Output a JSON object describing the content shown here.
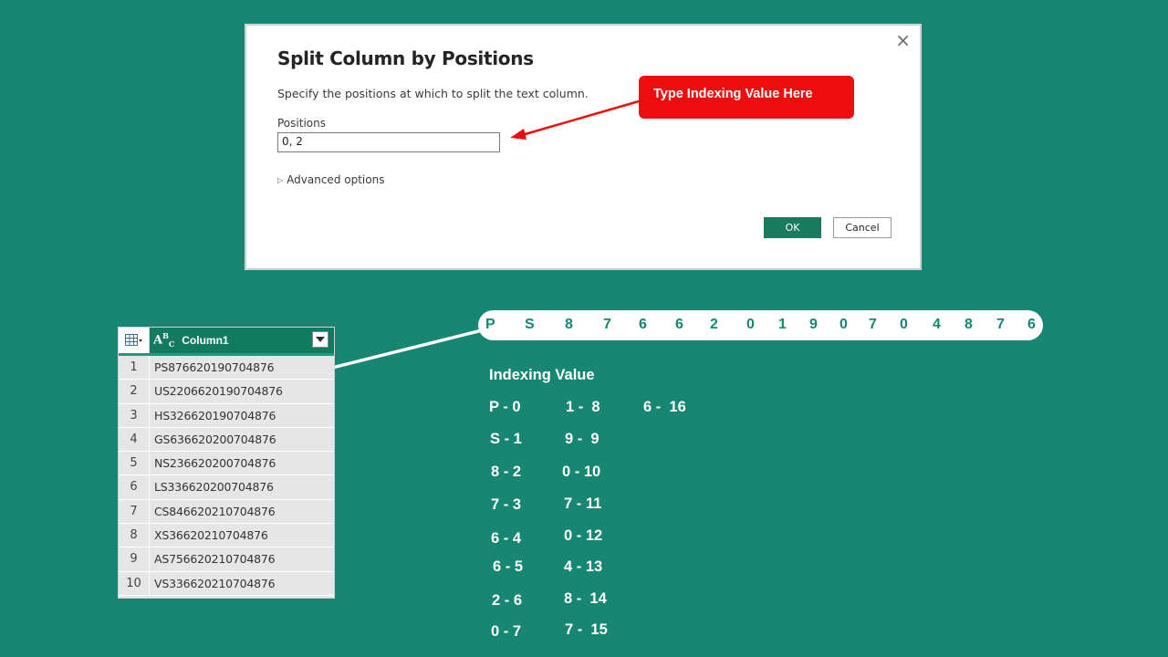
{
  "dialog": {
    "title": "Split Column by Positions",
    "subtitle": "Specify the positions at which to split the text column.",
    "positions_label": "Positions",
    "positions_value": "0, 2",
    "advanced_label": "Advanced options",
    "ok_label": "OK",
    "cancel_label": "Cancel",
    "close_glyph": "×"
  },
  "callout": {
    "text": "Type Indexing Value Here"
  },
  "grid": {
    "column_header": "Column1",
    "rows": [
      {
        "n": "1",
        "value": "PS876620190704876"
      },
      {
        "n": "2",
        "value": "US2206620190704876"
      },
      {
        "n": "3",
        "value": "HS326620190704876"
      },
      {
        "n": "4",
        "value": "GS636620200704876"
      },
      {
        "n": "5",
        "value": "NS236620200704876"
      },
      {
        "n": "6",
        "value": "LS336620200704876"
      },
      {
        "n": "7",
        "value": "CS846620210704876"
      },
      {
        "n": "8",
        "value": "XS36620210704876"
      },
      {
        "n": "9",
        "value": "AS756620210704876"
      },
      {
        "n": "10",
        "value": "VS336620210704876"
      }
    ]
  },
  "strip": {
    "chars": [
      "P",
      "S",
      "8",
      "7",
      "6",
      "6",
      "2",
      "0",
      "1",
      "9",
      "0",
      "7",
      "0",
      "4",
      "8",
      "7",
      "6"
    ]
  },
  "indexing": {
    "title": "Indexing Value",
    "pairs": [
      "P - 0",
      "S - 1",
      "8 - 2",
      "7 - 3",
      "6 - 4",
      "6 - 5",
      "2 - 6",
      "0 - 7",
      "1 -  8",
      "9 -  9",
      "0 - 10",
      "7 - 11",
      "0 - 12",
      "4 - 13",
      "8 -  14",
      "7 -  15",
      "6 -  16"
    ]
  },
  "colors": {
    "background": "#178672",
    "callout": "#ee0d0d",
    "ok_button": "#1a7a5e",
    "header": "#127a5f"
  }
}
